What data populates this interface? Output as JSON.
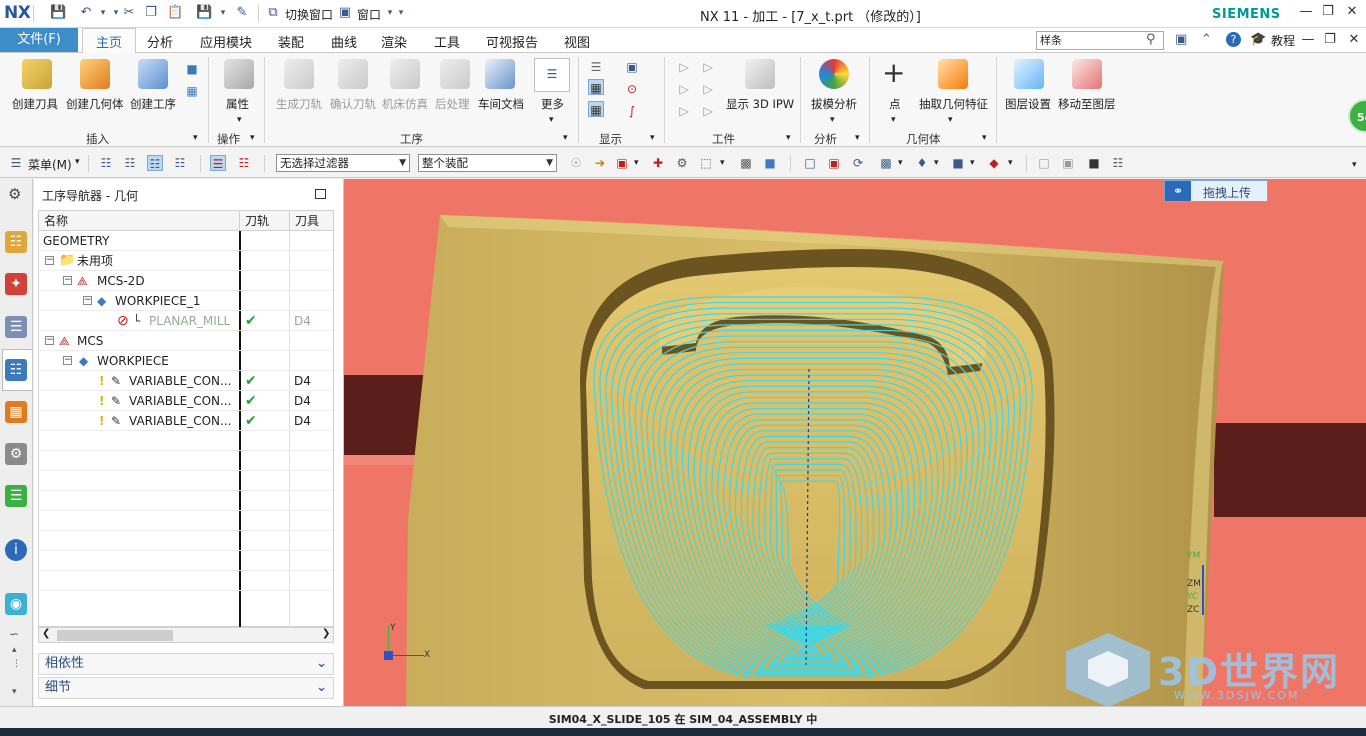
{
  "app": {
    "logo": "NX",
    "window_title": "NX 11 - 加工 - [7_x_t.prt （修改的）]",
    "brand": "SIEMENS",
    "quick_access": {
      "switch_window": "切换窗口",
      "window_menu": "窗口"
    }
  },
  "menubar": {
    "file": "文件(F)",
    "tabs": [
      "主页",
      "分析",
      "应用模块",
      "装配",
      "曲线",
      "渲染",
      "工具",
      "可视报告",
      "视图"
    ],
    "active_tab": "主页",
    "search_placeholder": "样条",
    "tutorial": "教程"
  },
  "ribbon": {
    "insert": {
      "buttons": [
        "创建刀具",
        "创建几何体",
        "创建工序"
      ],
      "group": "插入"
    },
    "operation": {
      "buttons": [
        "属性"
      ],
      "group": "操作"
    },
    "procedure": {
      "buttons": [
        "生成刀轨",
        "确认刀轨",
        "机床仿真",
        "后处理",
        "车间文档",
        "更多"
      ],
      "group": "工序"
    },
    "display": {
      "group": "显示"
    },
    "workpiece": {
      "buttons": [
        "显示 3D IPW"
      ],
      "group": "工件"
    },
    "analysis": {
      "buttons": [
        "拔模分析"
      ],
      "group": "分析"
    },
    "geometry": {
      "buttons": [
        "点",
        "抽取几何特征"
      ],
      "group": "几何体"
    },
    "layers": {
      "buttons": [
        "图层设置",
        "移动至图层"
      ]
    },
    "badge": "54"
  },
  "seltoolbar": {
    "menu": "菜单(M)",
    "filter": "无选择过滤器",
    "scope": "整个装配"
  },
  "navigator": {
    "title": "工序导航器 - 几何",
    "columns": [
      "名称",
      "刀轨",
      "刀具"
    ],
    "rows": [
      {
        "name": "GEOMETRY",
        "path": "",
        "tool": ""
      },
      {
        "name": "未用项",
        "path": "",
        "tool": ""
      },
      {
        "name": "MCS-2D",
        "path": "",
        "tool": ""
      },
      {
        "name": "WORKPIECE_1",
        "path": "",
        "tool": ""
      },
      {
        "name": "PLANAR_MILL",
        "path": "✔",
        "tool": "D4"
      },
      {
        "name": "MCS",
        "path": "",
        "tool": ""
      },
      {
        "name": "WORKPIECE",
        "path": "",
        "tool": ""
      },
      {
        "name": "VARIABLE_CON...",
        "path": "✔",
        "tool": "D4"
      },
      {
        "name": "VARIABLE_CON...",
        "path": "✔",
        "tool": "D4"
      },
      {
        "name": "VARIABLE_CON...",
        "path": "✔",
        "tool": "D4"
      }
    ],
    "panels": [
      "相依性",
      "细节"
    ]
  },
  "viewport": {
    "upload_button": "拖拽上传",
    "triad_labels": [
      "YM",
      "ZM",
      "YC",
      "ZC"
    ],
    "wcs_labels": [
      "Y",
      "X"
    ],
    "watermark": "3D世界网",
    "watermark_url": "WWW.3DSJW.COM"
  },
  "statusbar": {
    "text": "SIM04_X_SLIDE_105 在 SIM_04_ASSEMBLY 中"
  }
}
